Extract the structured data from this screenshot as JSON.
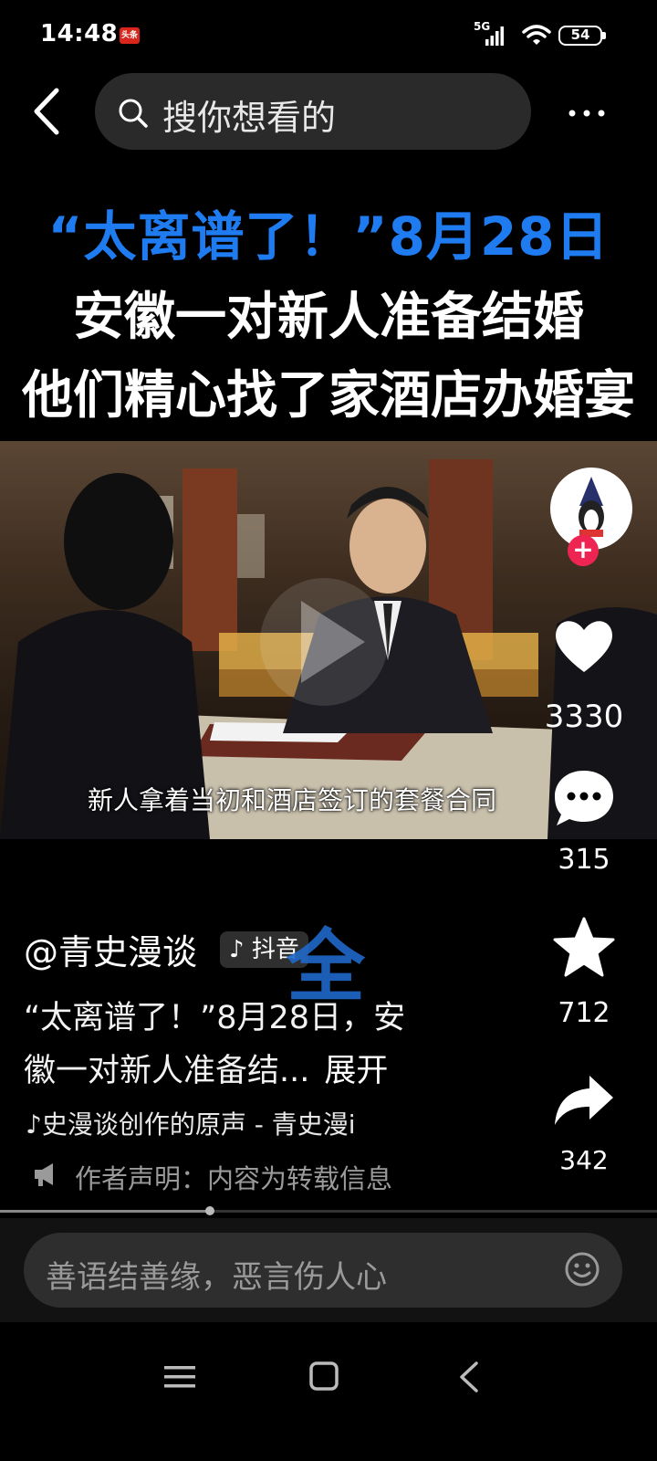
{
  "status_bar": {
    "time": "14:48",
    "app_badge": "头条",
    "network": "5G",
    "battery": "54",
    "icons": [
      "signal-icon",
      "wifi-icon",
      "battery-icon"
    ]
  },
  "search": {
    "placeholder": "搜你想看的",
    "icons": [
      "back-icon",
      "search-icon",
      "more-icon"
    ]
  },
  "headline": {
    "line1": "“太离谱了！”8月28日",
    "line2": "安徽一对新人准备结婚",
    "line3": "他们精心找了家酒店办婚宴"
  },
  "video": {
    "subtitle": "新人拿着当初和酒店签订的套餐合同"
  },
  "actions": {
    "likes": "3330",
    "comments": "315",
    "favorites": "712",
    "shares": "342",
    "follow": "+",
    "icons": [
      "heart-icon",
      "comment-icon",
      "star-icon",
      "share-icon"
    ]
  },
  "post": {
    "author": "@青史漫谈",
    "platform_tag": "抖音",
    "watermark": "全",
    "caption_line1": "“太离谱了！”8月28日，安",
    "caption_line2": "徽一对新人准备结...",
    "expand": "展开",
    "music": "史漫谈创作的原声 - 青史漫i",
    "declaration": "作者声明：内容为转载信息"
  },
  "progress": {
    "played_fraction": 0.32
  },
  "comment_bar": {
    "placeholder": "善语结善缘，恶言伤人心"
  },
  "colors": {
    "headline_blue": "#1f7cf0",
    "follow_red": "#ee2452",
    "background": "#000000"
  }
}
